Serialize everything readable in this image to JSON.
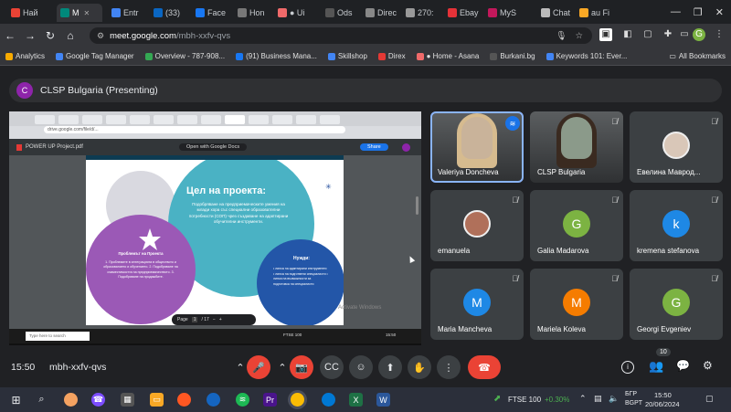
{
  "browser": {
    "tabs": [
      {
        "label": "Най",
        "icon": "gmail-icon",
        "color": "#ea4335",
        "active": false
      },
      {
        "label": "M",
        "icon": "meet-icon",
        "color": "#00897b",
        "active": true
      },
      {
        "label": "Entr",
        "icon": "docs-icon",
        "color": "#4285f4",
        "active": false
      },
      {
        "label": "(33)",
        "icon": "linkedin-icon",
        "color": "#0a66c2",
        "active": false
      },
      {
        "label": "Face",
        "icon": "facebook-icon",
        "color": "#1877f2",
        "active": false
      },
      {
        "label": "Hon",
        "icon": "globe-icon",
        "color": "#777",
        "active": false
      },
      {
        "label": "● Ui",
        "icon": "asana-icon",
        "color": "#f06a6a",
        "active": false
      },
      {
        "label": "Ods",
        "icon": "globe-icon",
        "color": "#555",
        "active": false
      },
      {
        "label": "Direc",
        "icon": "direct-icon",
        "color": "#888",
        "active": false
      },
      {
        "label": "270:",
        "icon": "doc-icon",
        "color": "#999",
        "active": false
      },
      {
        "label": "Ebay",
        "icon": "ebay-icon",
        "color": "#e53238",
        "active": false
      },
      {
        "label": "MyS",
        "icon": "mys-icon",
        "color": "#c2185b",
        "active": false
      },
      {
        "label": "Chat",
        "icon": "chat-icon",
        "color": "#bbb",
        "active": false
      },
      {
        "label": "au Fi",
        "icon": "folder-icon",
        "color": "#f9a825",
        "active": false
      }
    ],
    "url_host": "meet.google.com",
    "url_path": "/mbh-xxfv-qvs",
    "bookmarks": [
      {
        "label": "Analytics",
        "color": "#f9ab00"
      },
      {
        "label": "Google Tag Manager",
        "color": "#4285f4"
      },
      {
        "label": "Overview - 787-908...",
        "color": "#34a853"
      },
      {
        "label": "(91) Business Mana...",
        "color": "#1877f2"
      },
      {
        "label": "Skillshop",
        "color": "#4285f4"
      },
      {
        "label": "Direx",
        "color": "#e53935"
      },
      {
        "label": "● Home - Asana",
        "color": "#f06a6a"
      },
      {
        "label": "Burkani.bg",
        "color": "#555"
      },
      {
        "label": "Keywords 101: Ever...",
        "color": "#4285f4"
      }
    ],
    "all_bookmarks": "All Bookmarks"
  },
  "meet": {
    "presenter_initial": "C",
    "presenting_label": "CLSP Bulgaria (Presenting)",
    "time": "15:50",
    "meeting_code": "mbh-xxfv-qvs",
    "participant_count": "10",
    "participants": [
      {
        "name": "Valeriya Doncheva",
        "type": "video",
        "color": "#c9b39a",
        "mic": "speaking"
      },
      {
        "name": "CLSP Bulgaria",
        "type": "video",
        "color": "#8b9a8a",
        "mic": "off"
      },
      {
        "name": "Евелина Маврод...",
        "type": "photo",
        "color": "#d9c7b8",
        "mic": "off"
      },
      {
        "name": "emanuela",
        "type": "photo",
        "color": "#b0705a",
        "mic": "off"
      },
      {
        "name": "Galia Madarova",
        "initial": "G",
        "type": "initial",
        "color": "#7cb342",
        "mic": "off"
      },
      {
        "name": "kremena stefanova",
        "initial": "k",
        "type": "initial",
        "color": "#1e88e5",
        "mic": "off"
      },
      {
        "name": "Maria Mancheva",
        "initial": "M",
        "type": "initial",
        "color": "#1e88e5",
        "mic": "off"
      },
      {
        "name": "Mariela Koleva",
        "initial": "M",
        "type": "initial",
        "color": "#f57c00",
        "mic": "off"
      },
      {
        "name": "Georgi Evgeniev",
        "initial": "G",
        "type": "initial",
        "color": "#7cb342",
        "mic": "off"
      }
    ]
  },
  "shared": {
    "file_name": "POWER UP Project.pdf",
    "open_with": "Open with Google Docs",
    "share_btn": "Share",
    "slide_title": "Цел на проекта:",
    "slide_body": "Подобряване на предприемаческите умения на млади хора със специални образователни потребности (СОП) чрез създаване на адаптирани обучителни инструменти.",
    "left_circle_title": "Проблемът на Проекта",
    "left_circle_body": "1. Проблемите в интеграцията в обществото и образованието и обучението. 2. Подобряване на съвместимостта на предприемачеството. 3. Подобряване на продажбите.",
    "right_circle_title": "Нужди:",
    "right_circle_body": "• липса на адаптирани инструменти • липса на подготвени специалисти • липса на възможности за подготовка на специалисти",
    "page_label": "Page",
    "page_num": "1",
    "page_total": "/ 17",
    "activate_windows": "Activate Windows",
    "search_label": "Type here to search",
    "ftse_small": "FTSE 100",
    "clock_small": "15:50"
  },
  "taskbar": {
    "ftse": "FTSE 100",
    "ftse_change": "+0.30%",
    "lang": "БГР",
    "lang2": "BGPT",
    "time": "15:50",
    "date": "20/06/2024"
  }
}
